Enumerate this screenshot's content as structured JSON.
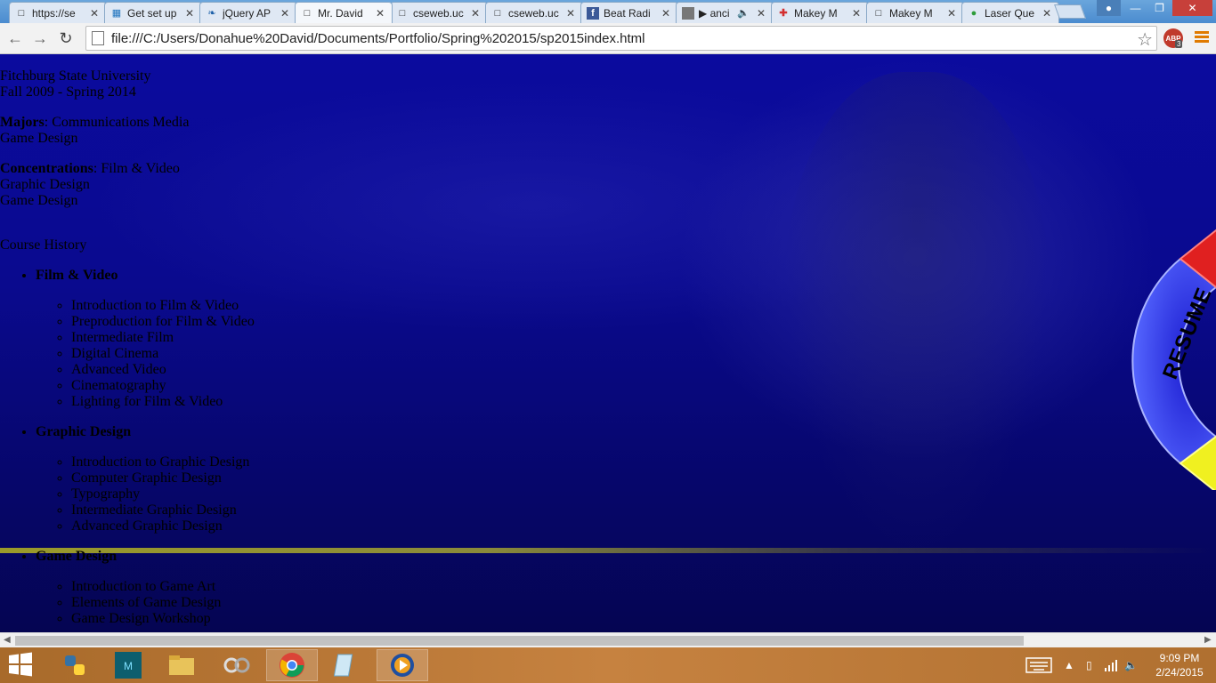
{
  "tabs": [
    {
      "title": "https://se",
      "icon": "page-icon"
    },
    {
      "title": "Get set up",
      "icon": "windows-icon"
    },
    {
      "title": "jQuery AP",
      "icon": "jquery-icon"
    },
    {
      "title": "Mr. David",
      "icon": "page-icon",
      "active": true
    },
    {
      "title": "cseweb.uc",
      "icon": "page-icon"
    },
    {
      "title": "cseweb.uc",
      "icon": "page-icon"
    },
    {
      "title": "Beat Radi",
      "icon": "facebook-icon"
    },
    {
      "title": "▶ anci",
      "icon": "video-thumb-icon"
    },
    {
      "title": "Makey M",
      "icon": "medical-cross-icon"
    },
    {
      "title": "Makey M",
      "icon": "page-icon"
    },
    {
      "title": "Laser Que",
      "icon": "maps-icon"
    }
  ],
  "toolbar": {
    "url": "file:///C:/Users/Donahue%20David/Documents/Portfolio/Spring%202015/sp2015index.html",
    "abp_label": "ABP",
    "abp_count": "3"
  },
  "page": {
    "school": "Fitchburg State University",
    "dates": "Fall 2009 - Spring 2014",
    "majors_label": "Majors",
    "majors_first": ": Communications Media",
    "majors_second": "Game Design",
    "concentrations_label": "Concentrations",
    "concentrations_first": ": Film & Video",
    "concentrations_second": "Graphic Design",
    "concentrations_third": "Game Design",
    "course_history": "Course History",
    "groups": [
      {
        "name": "Film & Video",
        "courses": [
          "Introduction to Film & Video",
          "Preproduction for Film & Video",
          "Intermediate Film",
          "Digital Cinema",
          "Advanced Video",
          "Cinematography",
          "Lighting for Film & Video"
        ]
      },
      {
        "name": "Graphic Design",
        "courses": [
          "Introduction to Graphic Design",
          "Computer Graphic Design",
          "Typography",
          "Intermediate Graphic Design",
          "Advanced Graphic Design"
        ]
      },
      {
        "name": "Game Design",
        "courses": [
          "Introduction to Game Art",
          "Elements of Game Design",
          "Game Design Workshop"
        ]
      }
    ],
    "resume_label": "RESUME"
  },
  "taskbar": {
    "apps": [
      "python-icon",
      "maya-icon",
      "file-explorer-icon",
      "network-icon",
      "chrome-icon",
      "notepad-icon",
      "media-player-icon"
    ],
    "active_app": "chrome-icon",
    "time": "9:09 PM",
    "date": "2/24/2015"
  },
  "colors": {
    "page_background": "#0a0a8e",
    "stripe": "#9a9a2a",
    "taskbar": "#c68240"
  }
}
